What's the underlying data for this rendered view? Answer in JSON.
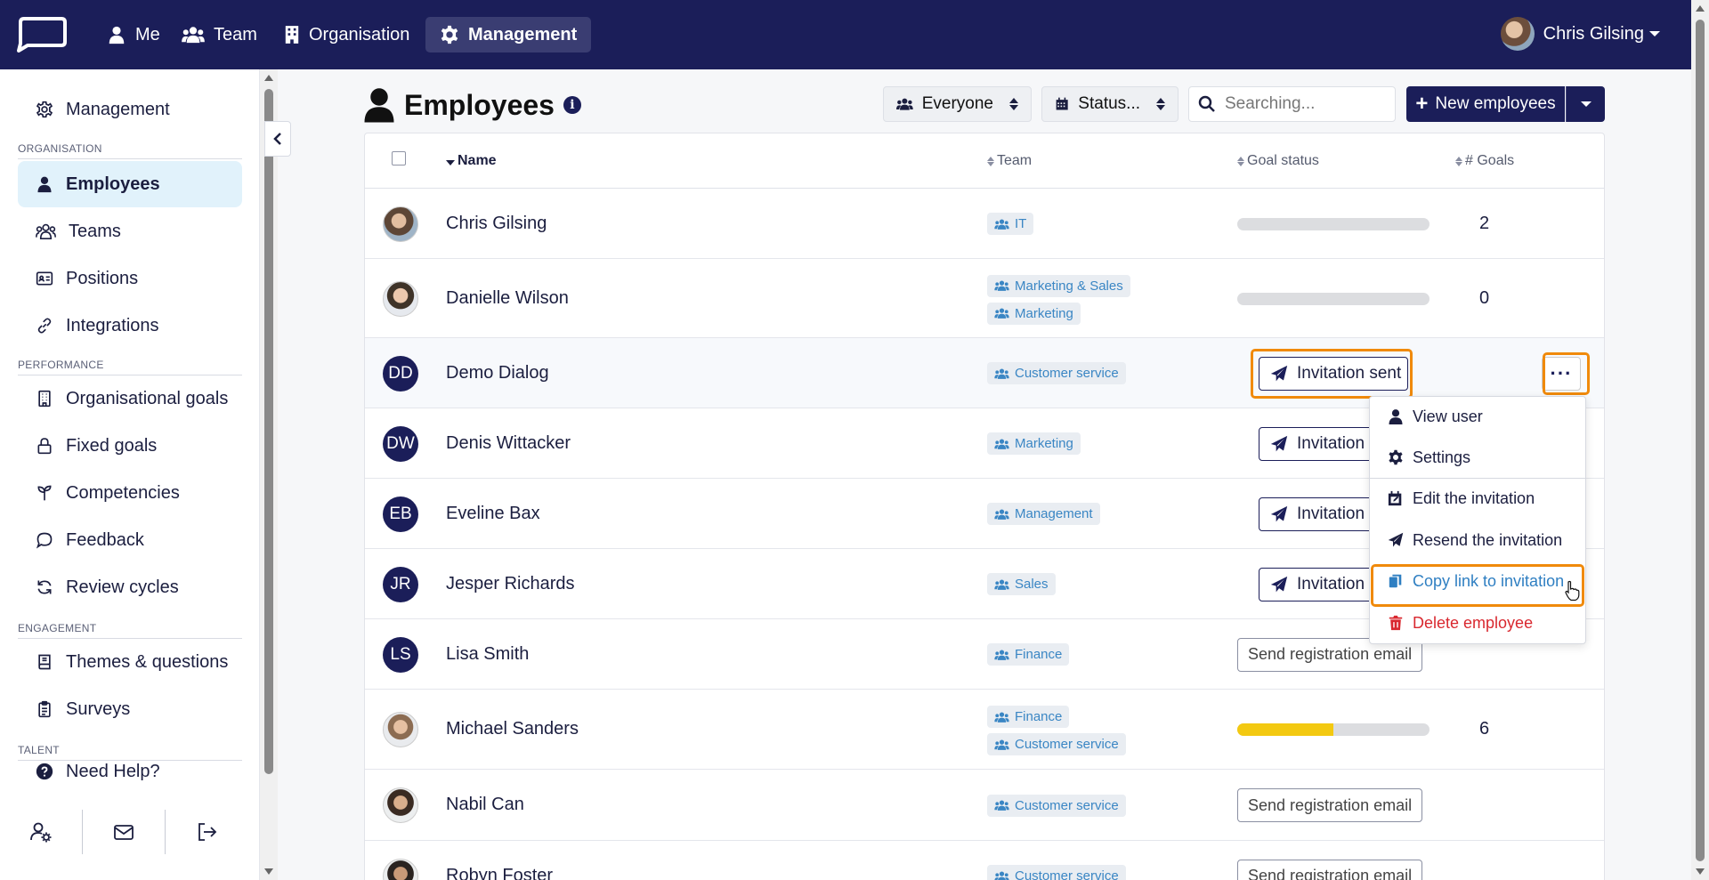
{
  "topbar": {
    "nav": [
      {
        "label": "Me",
        "icon": "user-icon"
      },
      {
        "label": "Team",
        "icon": "users-icon"
      },
      {
        "label": "Organisation",
        "icon": "building-icon"
      },
      {
        "label": "Management",
        "icon": "gear-icon",
        "active": true
      }
    ],
    "user_name": "Chris Gilsing"
  },
  "sidebar": {
    "top_item": "Management",
    "sections": {
      "organisation": "ORGANISATION",
      "performance": "PERFORMANCE",
      "engagement": "ENGAGEMENT",
      "talent": "TALENT"
    },
    "organisation_items": [
      "Employees",
      "Teams",
      "Positions",
      "Integrations"
    ],
    "performance_items": [
      "Organisational goals",
      "Fixed goals",
      "Competencies",
      "Feedback",
      "Review cycles"
    ],
    "engagement_items": [
      "Themes & questions",
      "Surveys"
    ],
    "help": "Need Help?"
  },
  "header": {
    "title": "Employees",
    "filter_people": "Everyone",
    "filter_status": "Status...",
    "search_placeholder": "Searching...",
    "new_button": "New employees"
  },
  "table": {
    "columns": {
      "name": "Name",
      "team": "Team",
      "goal_status": "Goal status",
      "goals": "# Goals"
    },
    "rows": [
      {
        "name": "Chris Gilsing",
        "initials": "",
        "teams": [
          "IT"
        ],
        "status": "bar",
        "progress": 0,
        "goals": "2"
      },
      {
        "name": "Danielle Wilson",
        "initials": "",
        "teams": [
          "Marketing & Sales",
          "Marketing"
        ],
        "status": "bar",
        "progress": 0,
        "goals": "0"
      },
      {
        "name": "Demo Dialog",
        "initials": "DD",
        "teams": [
          "Customer service"
        ],
        "status": "invitation",
        "status_label": "Invitation sent"
      },
      {
        "name": "Denis Wittacker",
        "initials": "DW",
        "teams": [
          "Marketing"
        ],
        "status": "invitation",
        "status_label": "Invitation s"
      },
      {
        "name": "Eveline Bax",
        "initials": "EB",
        "teams": [
          "Management"
        ],
        "status": "invitation",
        "status_label": "Invitation s"
      },
      {
        "name": "Jesper Richards",
        "initials": "JR",
        "teams": [
          "Sales"
        ],
        "status": "invitation",
        "status_label": "Invitation s"
      },
      {
        "name": "Lisa Smith",
        "initials": "LS",
        "teams": [
          "Finance"
        ],
        "status": "registration",
        "status_label": "Send registration email"
      },
      {
        "name": "Michael Sanders",
        "initials": "",
        "teams": [
          "Finance",
          "Customer service"
        ],
        "status": "bar",
        "progress": 0.5,
        "goals": "6"
      },
      {
        "name": "Nabil Can",
        "initials": "",
        "teams": [
          "Customer service"
        ],
        "status": "registration",
        "status_label": "Send registration email"
      },
      {
        "name": "Robyn Foster",
        "initials": "",
        "teams": [
          "Customer service"
        ],
        "status": "registration",
        "status_label": "Send registration email"
      }
    ]
  },
  "row_menu": {
    "view_user": "View user",
    "settings": "Settings",
    "edit_invitation": "Edit the invitation",
    "resend_invitation": "Resend the invitation",
    "copy_link": "Copy link to invitation",
    "delete": "Delete employee"
  },
  "colors": {
    "navy": "#1b1e59",
    "highlight": "#f08a0b",
    "tag_text": "#3a86c4",
    "danger": "#d9282f",
    "progress": "#f3c911"
  }
}
